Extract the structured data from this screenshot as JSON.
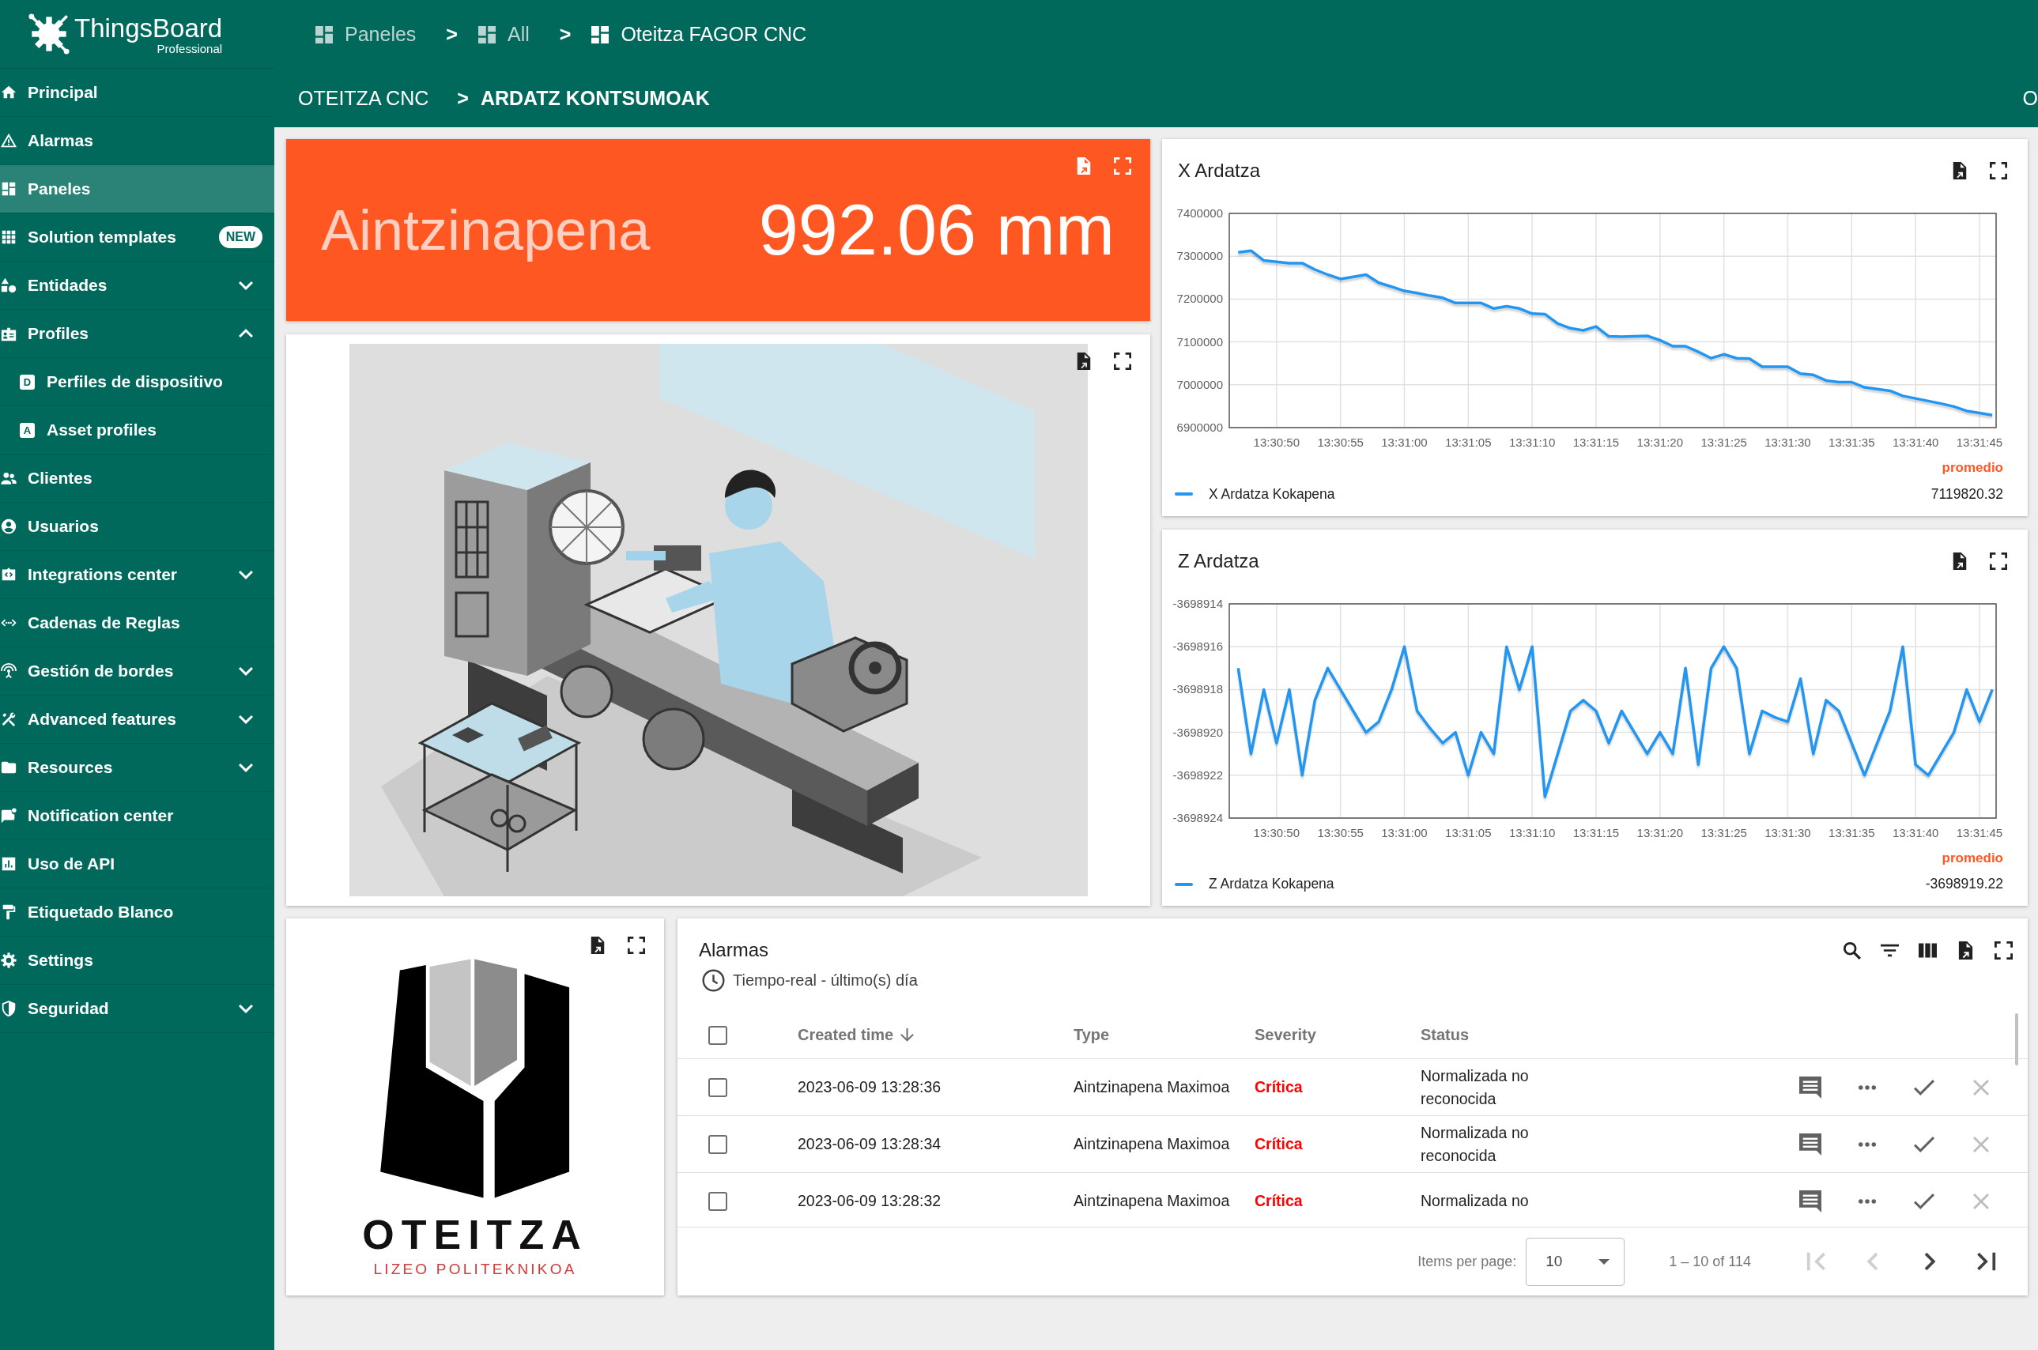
{
  "sidebar": {
    "brand": {
      "name": "ThingsBoard",
      "edition": "Professional"
    },
    "items": [
      {
        "label": "Principal",
        "selected": false
      },
      {
        "label": "Alarmas",
        "selected": false
      },
      {
        "label": "Paneles",
        "selected": true
      },
      {
        "label": "Solution templates",
        "selected": false,
        "badge": "NEW"
      },
      {
        "label": "Entidades",
        "selected": false,
        "expanded": false
      },
      {
        "label": "Profiles",
        "selected": false,
        "expanded": true,
        "children": [
          {
            "label": "Perfiles de dispositivo",
            "icon_text": "D",
            "selected": false
          },
          {
            "label": "Asset profiles",
            "icon_text": "A",
            "selected": false
          }
        ]
      },
      {
        "label": "Clientes",
        "selected": false
      },
      {
        "label": "Usuarios",
        "selected": false
      },
      {
        "label": "Integrations center",
        "selected": false,
        "expanded": false
      },
      {
        "label": "Cadenas de Reglas",
        "selected": false
      },
      {
        "label": "Gestión de bordes",
        "selected": false,
        "expanded": false
      },
      {
        "label": "Advanced features",
        "selected": false,
        "expanded": false
      },
      {
        "label": "Resources",
        "selected": false,
        "expanded": false
      },
      {
        "label": "Notification center",
        "selected": false
      },
      {
        "label": "Uso de API",
        "selected": false
      },
      {
        "label": "Etiquetado Blanco",
        "selected": false
      },
      {
        "label": "Settings",
        "selected": false
      },
      {
        "label": "Seguridad",
        "selected": false,
        "expanded": false
      }
    ]
  },
  "header": {
    "breadcrumb": [
      {
        "label": "Paneles",
        "active": false
      },
      {
        "label": "All",
        "separator": ">",
        "active": false
      },
      {
        "label": "Oteitza FAGOR CNC",
        "separator": ">",
        "active": true
      }
    ],
    "state_breadcrumb": [
      {
        "label": "OTEITZA CNC",
        "active": false
      },
      {
        "label": "ARDATZ KONTSUMOAK",
        "separator": ">",
        "active": true
      }
    ],
    "edge_text": "O"
  },
  "value_card": {
    "label": "Aintzinapena",
    "value": "992.06 mm"
  },
  "x_chart": {
    "title": "X Ardatza",
    "chart_data": {
      "type": "line",
      "grid": true,
      "categories": [
        null,
        null,
        null,
        "13:30:50",
        null,
        null,
        null,
        null,
        "13:30:55",
        null,
        null,
        null,
        null,
        "13:31:00",
        null,
        null,
        null,
        null,
        "13:31:05",
        null,
        null,
        null,
        null,
        "13:31:10",
        null,
        null,
        null,
        null,
        "13:31:15",
        null,
        null,
        null,
        null,
        "13:31:20",
        null,
        null,
        null,
        null,
        "13:31:25",
        null,
        null,
        null,
        null,
        "13:31:30",
        null,
        null,
        null,
        null,
        "13:31:35",
        null,
        null,
        null,
        null,
        "13:31:40",
        null,
        null,
        null,
        null,
        "13:31:45",
        null
      ],
      "series": [
        {
          "name": "X Ardatza Kokapena",
          "color": "#2196f3",
          "values": [
            7309000,
            7313000,
            7290000,
            7287000,
            7284000,
            7284000,
            7269000,
            7257000,
            7247000,
            7252000,
            7257000,
            7238000,
            7229000,
            7219000,
            7214000,
            7208000,
            7203000,
            7191000,
            7191000,
            7191000,
            7178000,
            7183000,
            7178000,
            7166000,
            7165000,
            7143000,
            7132000,
            7127000,
            7136000,
            7113000,
            7112000,
            7113000,
            7114000,
            7104000,
            7090000,
            7090000,
            7077000,
            7062000,
            7071000,
            7062000,
            7061000,
            7042000,
            7042000,
            7042000,
            7026000,
            7023000,
            7010000,
            7006000,
            7006000,
            6994000,
            6990000,
            6986000,
            6974000,
            6968000,
            6962000,
            6956000,
            6949000,
            6939000,
            6934000,
            6929000
          ]
        }
      ],
      "ylim": [
        6900000,
        7400000
      ],
      "yticks": [
        6900000,
        7000000,
        7100000,
        7200000,
        7300000,
        7400000
      ]
    },
    "legend": {
      "stat_label": "promedio",
      "stat_value": "7119820.32"
    }
  },
  "z_chart": {
    "title": "Z Ardatza",
    "chart_data": {
      "type": "line",
      "grid": true,
      "categories": [
        null,
        null,
        null,
        "13:30:50",
        null,
        null,
        null,
        null,
        "13:30:55",
        null,
        null,
        null,
        null,
        "13:31:00",
        null,
        null,
        null,
        null,
        "13:31:05",
        null,
        null,
        null,
        null,
        "13:31:10",
        null,
        null,
        null,
        null,
        "13:31:15",
        null,
        null,
        null,
        null,
        "13:31:20",
        null,
        null,
        null,
        null,
        "13:31:25",
        null,
        null,
        null,
        null,
        "13:31:30",
        null,
        null,
        null,
        null,
        "13:31:35",
        null,
        null,
        null,
        null,
        "13:31:40",
        null,
        null,
        null,
        null,
        "13:31:45",
        null
      ],
      "series": [
        {
          "name": "Z Ardatza Kokapena",
          "color": "#2196f3",
          "values": [
            -3698917,
            -3698921,
            -3698918,
            -3698920.5,
            -3698918,
            -3698922,
            -3698918.5,
            -3698917,
            -3698918,
            -3698919,
            -3698920,
            -3698919.5,
            -3698918,
            -3698916,
            -3698919,
            -3698919.8,
            -3698920.5,
            -3698920,
            -3698922,
            -3698920,
            -3698921,
            -3698916,
            -3698918,
            -3698916,
            -3698923,
            -3698921,
            -3698919,
            -3698918.5,
            -3698919,
            -3698920.5,
            -3698919,
            -3698920,
            -3698921,
            -3698920,
            -3698921,
            -3698917,
            -3698921.5,
            -3698917,
            -3698916,
            -3698917,
            -3698921,
            -3698919,
            -3698919.3,
            -3698919.5,
            -3698917.5,
            -3698921,
            -3698918.5,
            -3698919,
            -3698920.5,
            -3698922,
            -3698920.5,
            -3698919,
            -3698916,
            -3698921.5,
            -3698922,
            -3698921,
            -3698920,
            -3698918,
            -3698919.5,
            -3698918
          ]
        }
      ],
      "ylim": [
        -3698924,
        -3698914
      ],
      "yticks": [
        -3698924,
        -3698922,
        -3698920,
        -3698918,
        -3698916,
        -3698914
      ]
    },
    "legend": {
      "stat_label": "promedio",
      "stat_value": "-3698919.22"
    }
  },
  "logo_card": {
    "wordmark": "OTEITZA",
    "tagline": "LIZEO POLITEKNIKOA"
  },
  "alarms": {
    "title": "Alarmas",
    "time_window": "Tiempo-real - último(s) día",
    "header_checked": false,
    "columns": [
      {
        "label": "Created time",
        "sorted": true
      },
      {
        "label": "Type",
        "sorted": false
      },
      {
        "label": "Severity",
        "sorted": false
      },
      {
        "label": "Status",
        "sorted": false
      }
    ],
    "rows": [
      {
        "checked": false,
        "created_time": "2023-06-09 13:28:36",
        "type": "Aintzinapena Maximoa",
        "severity": "Crítica",
        "status": "Normalizada no reconocida"
      },
      {
        "checked": false,
        "created_time": "2023-06-09 13:28:34",
        "type": "Aintzinapena Maximoa",
        "severity": "Crítica",
        "status": "Normalizada no reconocida"
      },
      {
        "checked": false,
        "created_time": "2023-06-09 13:28:32",
        "type": "Aintzinapena Maximoa",
        "severity": "Crítica",
        "status": "Normalizada no"
      }
    ],
    "pagination": {
      "items_per_page_label": "Items per page:",
      "page_size": "10",
      "range": "1 – 10 of 114",
      "buttons": [
        {
          "kind": "first",
          "disabled": true
        },
        {
          "kind": "previous",
          "disabled": true
        },
        {
          "kind": "next",
          "disabled": false
        },
        {
          "kind": "last",
          "disabled": false
        }
      ]
    }
  }
}
